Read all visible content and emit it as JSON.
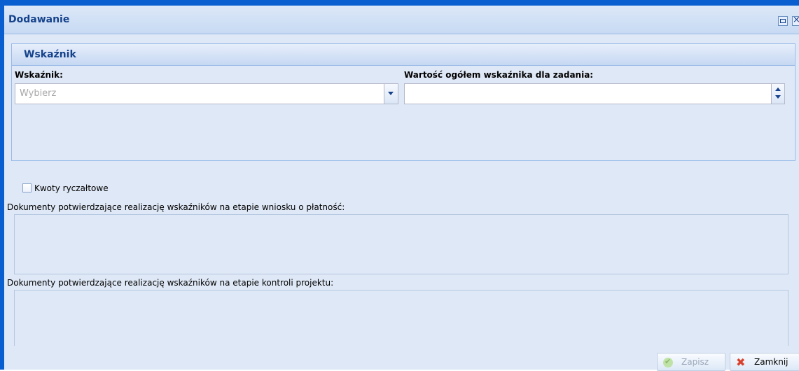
{
  "window": {
    "title": "Dodawanie",
    "maximize_icon": "maximize-icon",
    "close_icon": "close-icon"
  },
  "fieldset": {
    "title": "Wskaźnik"
  },
  "fields": {
    "indicator_label": "Wskaźnik:",
    "indicator_placeholder": "Wybierz",
    "total_value_label": "Wartość ogółem wskaźnika dla zadania:",
    "total_value": ""
  },
  "checkbox": {
    "label": "Kwoty ryczałtowe",
    "checked": false
  },
  "documents": {
    "payment_label": "Dokumenty potwierdzające realizację wskaźników na etapie wniosku o płatność:",
    "control_label": "Dokumenty potwierdzające realizację wskaźników na etapie kontroli projektu:"
  },
  "buttons": {
    "save": "Zapisz",
    "close": "Zamknij"
  },
  "colors": {
    "window_border": "#0a5fd0",
    "header_text": "#15428b",
    "panel_bg": "#dfe8f6"
  }
}
